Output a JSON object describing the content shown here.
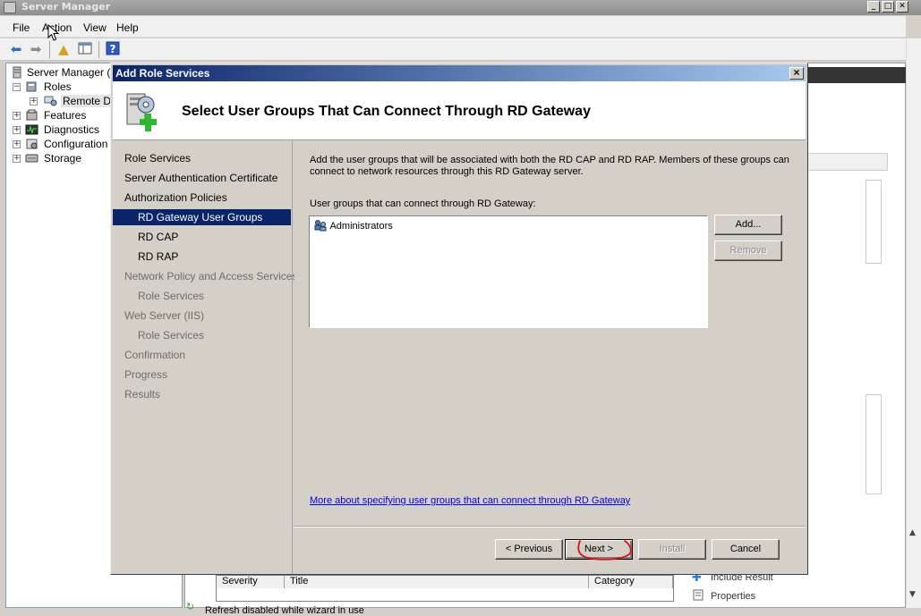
{
  "window": {
    "title": "Server Manager",
    "minimize": "_",
    "maximize": "□",
    "close": "✕"
  },
  "menu": [
    "File",
    "Action",
    "View",
    "Help"
  ],
  "toolbar": {
    "icons": [
      "back-arrow-icon",
      "forward-arrow-icon",
      "up-folder-icon",
      "show-hide-tree-icon",
      "help-icon"
    ]
  },
  "tree": {
    "root": "Server Manager (SE",
    "roles": "Roles",
    "remote_desktop": "Remote Des",
    "features": "Features",
    "diagnostics": "Diagnostics",
    "configuration": "Configuration",
    "storage": "Storage"
  },
  "dialog": {
    "title": "Add Role Services",
    "heading": "Select User Groups That Can Connect Through RD Gateway",
    "nav": [
      {
        "label": "Role Services",
        "state": "enabled",
        "indent": 0
      },
      {
        "label": "Server Authentication Certificate",
        "state": "enabled",
        "indent": 0
      },
      {
        "label": "Authorization Policies",
        "state": "enabled",
        "indent": 0
      },
      {
        "label": "RD Gateway User Groups",
        "state": "selected",
        "indent": 1
      },
      {
        "label": "RD CAP",
        "state": "enabled",
        "indent": 1
      },
      {
        "label": "RD RAP",
        "state": "enabled",
        "indent": 1
      },
      {
        "label": "Network Policy and Access Services",
        "state": "disabled",
        "indent": 0
      },
      {
        "label": "Role Services",
        "state": "disabled",
        "indent": 1
      },
      {
        "label": "Web Server (IIS)",
        "state": "disabled",
        "indent": 0
      },
      {
        "label": "Role Services",
        "state": "disabled",
        "indent": 1
      },
      {
        "label": "Confirmation",
        "state": "disabled",
        "indent": 0
      },
      {
        "label": "Progress",
        "state": "disabled",
        "indent": 0
      },
      {
        "label": "Results",
        "state": "disabled",
        "indent": 0
      }
    ],
    "description": "Add the user groups that will be associated with both the RD CAP and RD RAP. Members of these groups can connect to network resources through this RD Gateway server.",
    "groups_label": "User groups that can connect through RD Gateway:",
    "groups": [
      "Administrators"
    ],
    "add_button": "Add...",
    "remove_button": "Remove",
    "more_link": "More about specifying user groups that can connect through RD Gateway",
    "buttons": {
      "previous": "< Previous",
      "next": "Next >",
      "install": "Install",
      "cancel": "Cancel"
    }
  },
  "background": {
    "grid_columns": [
      "Severity",
      "Title",
      "Category"
    ],
    "actions": [
      "Include Result",
      "Properties"
    ],
    "status": "Refresh disabled while wizard in use"
  },
  "colors": {
    "dialog_title_start": "#0a246a",
    "dialog_title_end": "#a6caf0",
    "selection": "#0a246a",
    "link": "#0000ee",
    "annotation": "#e01010"
  }
}
